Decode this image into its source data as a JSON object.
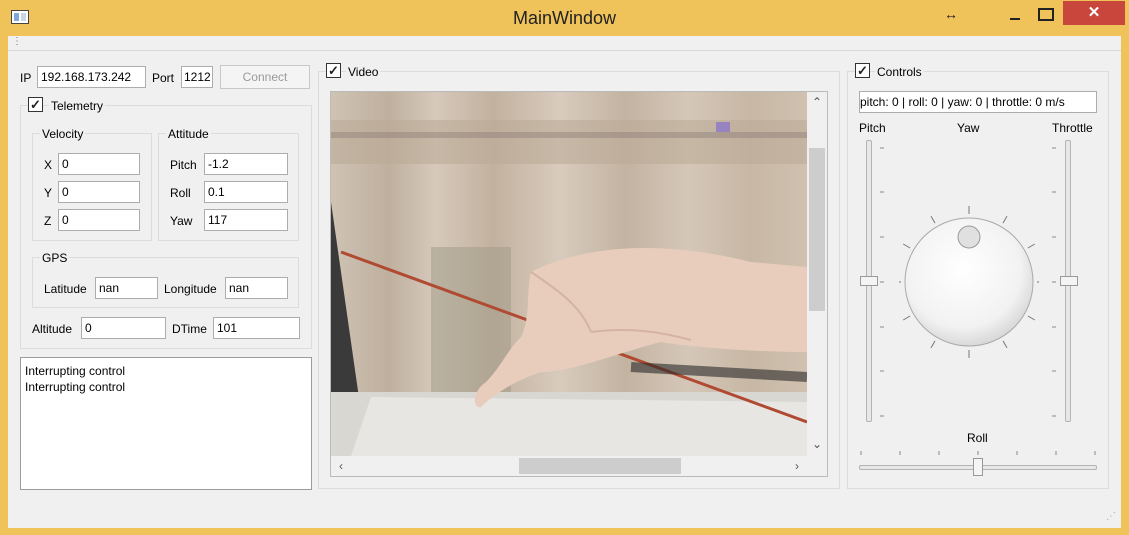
{
  "window": {
    "title": "MainWindow",
    "resize_glyph": "↔"
  },
  "menubar": {
    "glyph": "⋮"
  },
  "connection": {
    "ip_label": "IP",
    "ip_value": "192.168.173.242",
    "port_label": "Port",
    "port_value": "1212",
    "connect_label": "Connect"
  },
  "telemetry": {
    "label": "Telemetry",
    "velocity": {
      "title": "Velocity",
      "x_label": "X",
      "x_value": "0",
      "y_label": "Y",
      "y_value": "0",
      "z_label": "Z",
      "z_value": "0"
    },
    "attitude": {
      "title": "Attitude",
      "pitch_label": "Pitch",
      "pitch_value": "-1.2",
      "roll_label": "Roll",
      "roll_value": "0.1",
      "yaw_label": "Yaw",
      "yaw_value": "117"
    },
    "gps": {
      "title": "GPS",
      "latitude_label": "Latitude",
      "latitude_value": "nan",
      "longitude_label": "Longitude",
      "longitude_value": "nan"
    },
    "altitude_label": "Altitude",
    "altitude_value": "0",
    "dtime_label": "DTime",
    "dtime_value": "101"
  },
  "log": {
    "lines": [
      "Interrupting control",
      "Interrupting control"
    ]
  },
  "video": {
    "label": "Video"
  },
  "controls": {
    "label": "Controls",
    "status": "pitch: 0 | roll: 0 | yaw: 0 | throttle: 0 m/s",
    "pitch_label": "Pitch",
    "yaw_label": "Yaw",
    "throttle_label": "Throttle",
    "roll_label": "Roll",
    "pitch_level": 0.5,
    "throttle_level": 0.5,
    "roll_level": 0.5,
    "yaw_level": 0
  },
  "colors": {
    "titlebar": "#f0c25a",
    "close_button": "#c9463d",
    "panel_bg": "#f0f0f0"
  }
}
